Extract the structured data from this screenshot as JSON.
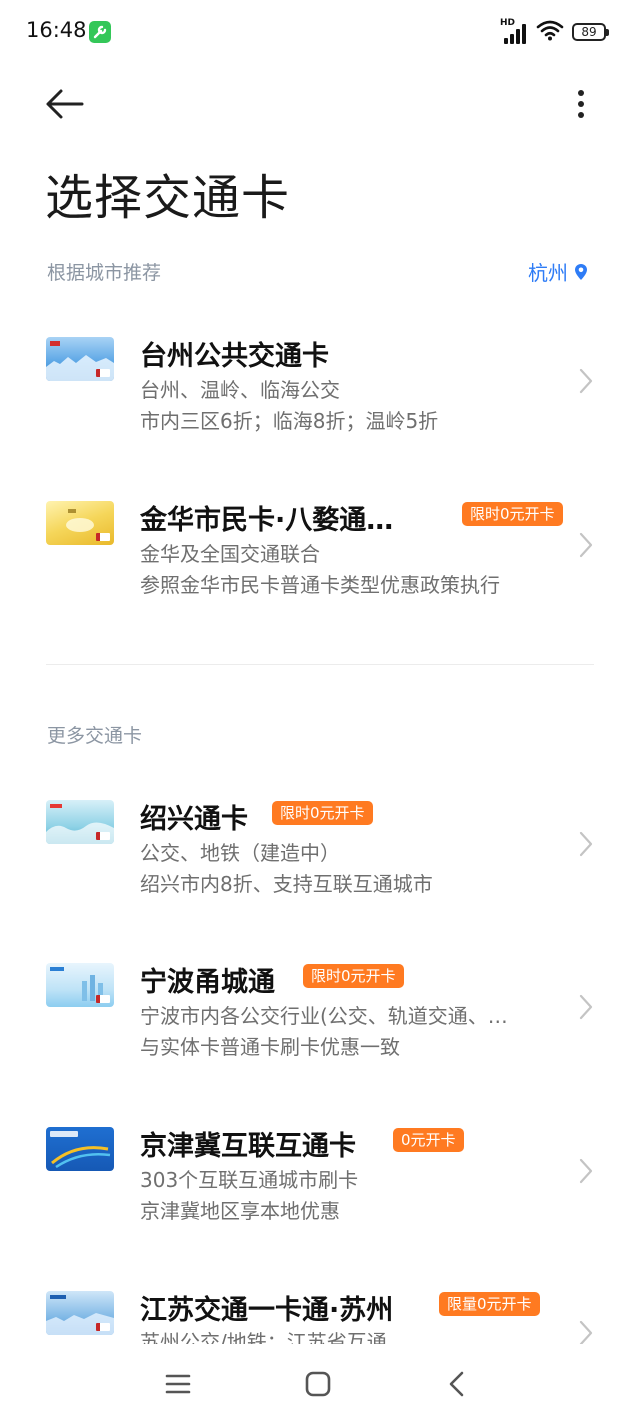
{
  "status_bar": {
    "time": "16:48",
    "network_label": "HD",
    "battery_level": "89"
  },
  "top_bar": {
    "back_icon": "arrow-left-icon",
    "more_icon": "more-vertical-icon"
  },
  "page": {
    "title": "选择交通卡"
  },
  "recommend": {
    "label": "根据城市推荐",
    "city": "杭州",
    "city_icon": "location-pin-icon"
  },
  "recommended_cards": [
    {
      "name": "台州公共交通卡",
      "badge": "",
      "line1": "台州、温岭、临海公交",
      "line2": "市内三区6折；临海8折；温岭5折"
    },
    {
      "name": "金华市民卡·八婺通…",
      "badge": "限时0元开卡",
      "line1": "金华及全国交通联合",
      "line2": "参照金华市民卡普通卡类型优惠政策执行"
    }
  ],
  "more": {
    "label": "更多交通卡"
  },
  "more_cards": [
    {
      "name": "绍兴通卡",
      "badge": "限时0元开卡",
      "line1": "公交、地铁（建造中）",
      "line2": "绍兴市内8折、支持互联互通城市"
    },
    {
      "name": "宁波甬城通",
      "badge": "限时0元开卡",
      "line1": "宁波市内各公交行业(公交、轨道交通、…",
      "line2": "与实体卡普通卡刷卡优惠一致"
    },
    {
      "name": "京津冀互联互通卡",
      "badge": "0元开卡",
      "line1": "303个互联互通城市刷卡",
      "line2": "京津冀地区享本地优惠"
    },
    {
      "name": "江苏交通一卡通·苏州",
      "badge": "限量0元开卡",
      "line1": "苏州公交/地铁；江苏省互通",
      "line2": ""
    }
  ],
  "nav_bar": {
    "menu_icon": "menu-icon",
    "home_icon": "home-square-icon",
    "back_icon": "back-chevron-icon"
  },
  "colors": {
    "accent": "#2e7cf6",
    "badge": "#ff7a21",
    "section_label": "#8c96a3"
  }
}
